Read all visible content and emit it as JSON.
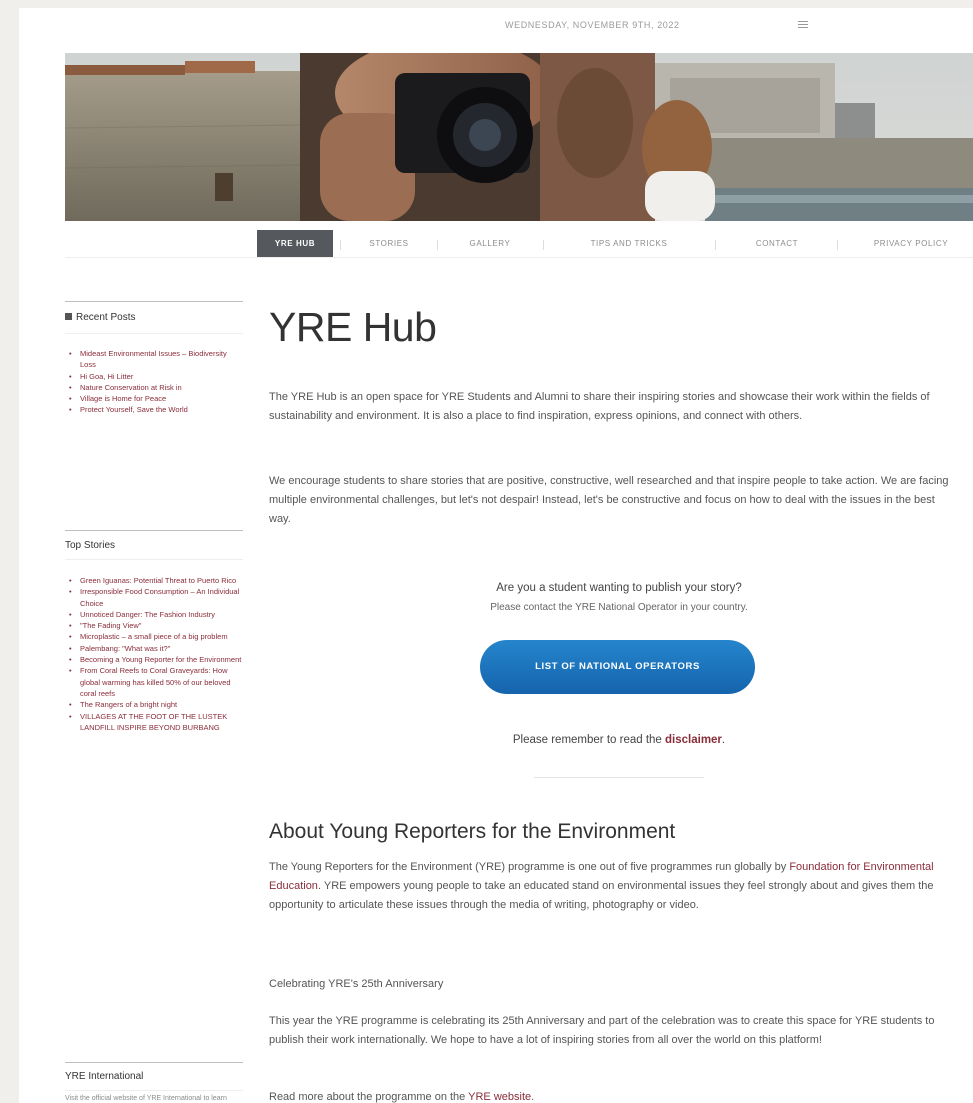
{
  "header": {
    "date": "WEDNESDAY, NOVEMBER 9TH, 2022"
  },
  "nav": {
    "items": [
      {
        "label": "YRE HUB",
        "active": true
      },
      {
        "label": "STORIES",
        "active": false
      },
      {
        "label": "GALLERY",
        "active": false
      },
      {
        "label": "TIPS AND TRICKS",
        "active": false
      },
      {
        "label": "CONTACT",
        "active": false
      },
      {
        "label": "PRIVACY POLICY",
        "active": false
      }
    ]
  },
  "sidebar": {
    "recent_posts": {
      "title": "Recent Posts",
      "items": [
        "Mideast Environmental Issues – Biodiversity Loss",
        "Hi Goa, Hi Litter",
        "Nature Conservation at Risk in",
        "Village is Home for Peace",
        "Protect Yourself, Save the World"
      ]
    },
    "top_stories": {
      "title": "Top Stories",
      "items": [
        "Green Iguanas: Potential Threat to Puerto Rico",
        "Irresponsible Food Consumption – An Individual Choice",
        "Unnoticed Danger: The Fashion Industry",
        "\"The Fading View\"",
        "Microplastic – a small piece of a big problem",
        "Palembang: \"What was it?\"",
        "Becoming a Young Reporter for the Environment",
        "From Coral Reefs to Coral Graveyards: How global warming has killed 50% of our beloved coral reefs",
        "The Rangers of a bright night",
        "VILLAGES AT THE FOOT OF THE LUSTEK LANDFILL INSPIRE BEYOND BURBANG"
      ]
    },
    "yre_international": {
      "title": "YRE International",
      "text": "Visit the official website of YRE International to learn more about"
    }
  },
  "main": {
    "title": "YRE Hub",
    "intro_1": "The YRE Hub is an open space for YRE Students and Alumni to share their inspiring stories and showcase their work within the fields of sustainability and environment. It is also a place to find inspiration, express opinions, and connect with others.",
    "intro_2": "We encourage students to share stories that are positive, constructive, well researched and that inspire people to take action. We are facing multiple environmental challenges, but let's not despair! Instead, let's be constructive and focus on how to deal with the issues in the best way.",
    "cta_question": "Are you a student wanting to publish your story?",
    "cta_instruction": "Please contact the YRE National Operator in your country.",
    "cta_button": "LIST OF NATIONAL OPERATORS",
    "disclaimer_prefix": "Please remember to read the ",
    "disclaimer_link": "disclaimer",
    "disclaimer_suffix": ".",
    "about_title": "About Young Reporters for the Environment",
    "about_text_before": "The Young Reporters for the Environment (YRE) programme is one out of five programmes run globally by ",
    "about_link": "Foundation for Environmental Education",
    "about_text_after": ". YRE empowers young people to take an educated stand on environmental issues they feel strongly about and gives them the opportunity to articulate these issues through the media of writing, photography or video.",
    "celebrating_title": "Celebrating YRE's 25th Anniversary",
    "celebrating_text": "This year the YRE programme is celebrating its 25th Anniversary and part of the celebration was to create this space for YRE students to publish their work internationally. We hope to have a lot of inspiring stories from all over the world on this platform!",
    "read_more_prefix": "Read more about the programme on the ",
    "read_more_link": "YRE website",
    "read_more_suffix": "."
  }
}
